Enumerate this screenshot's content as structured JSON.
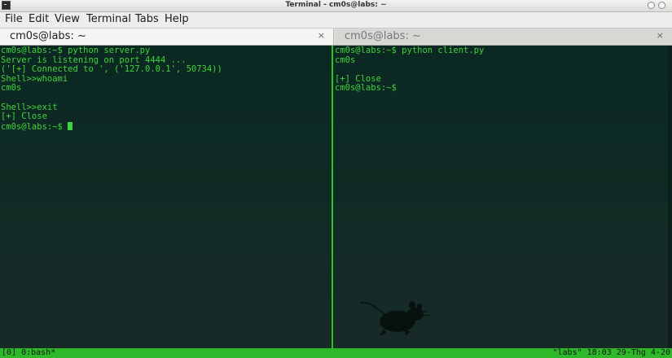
{
  "window": {
    "title": "Terminal - cm0s@labs: ~"
  },
  "menubar": {
    "items": [
      "File",
      "Edit",
      "View",
      "Terminal",
      "Tabs",
      "Help"
    ]
  },
  "tabs": [
    {
      "label": "cm0s@labs: ~",
      "active": true,
      "close": "×"
    },
    {
      "label": "cm0s@labs: ~",
      "active": false,
      "close": "×"
    }
  ],
  "panes": {
    "left": [
      "cm0s@labs:~$ python server.py",
      "Server is listening on port 4444 ...",
      "('[+] Connected to ', ('127.0.0.1', 50734))",
      "Shell>>whoami",
      "cm0s",
      "",
      "Shell>>exit",
      "[+] Close",
      "cm0s@labs:~$ "
    ],
    "right": [
      "cm0s@labs:~$ python client.py",
      "cm0s",
      "",
      "[+] Close",
      "cm0s@labs:~$"
    ]
  },
  "statusbar": {
    "left": "[0] 0:bash*",
    "right": "\"labs\" 18:03 29-Thg 4-20"
  },
  "colors": {
    "terminal_text": "#3fd33a",
    "terminal_bg": "#102a24",
    "status_bg": "#2fb82a"
  }
}
